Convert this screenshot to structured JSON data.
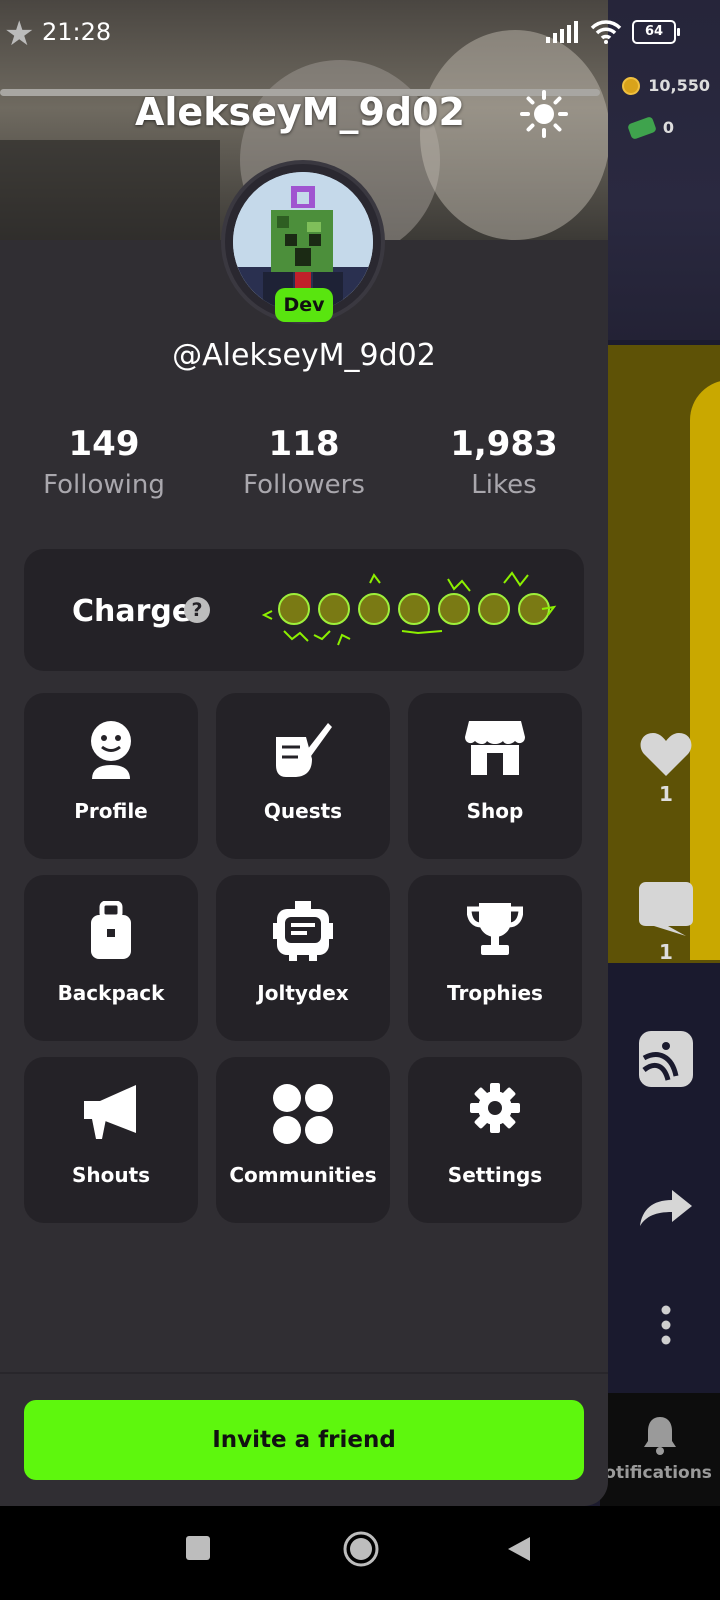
{
  "status_bar": {
    "time": "21:28",
    "battery": "64"
  },
  "drawer": {
    "title": "AlekseyM_9d02",
    "handle": "@AlekseyM_9d02",
    "badge": "Dev",
    "stats": [
      {
        "value": "149",
        "label": "Following"
      },
      {
        "value": "118",
        "label": "Followers"
      },
      {
        "value": "1,983",
        "label": "Likes"
      }
    ],
    "charge": {
      "label": "Charge",
      "help": "?"
    },
    "menu": [
      {
        "label": "Profile",
        "icon": "profile-icon"
      },
      {
        "label": "Quests",
        "icon": "quests-icon"
      },
      {
        "label": "Shop",
        "icon": "shop-icon"
      },
      {
        "label": "Backpack",
        "icon": "backpack-icon"
      },
      {
        "label": "Joltydex",
        "icon": "joltydex-icon"
      },
      {
        "label": "Trophies",
        "icon": "trophy-icon"
      },
      {
        "label": "Shouts",
        "icon": "megaphone-icon"
      },
      {
        "label": "Communities",
        "icon": "communities-icon"
      },
      {
        "label": "Settings",
        "icon": "gear-icon"
      }
    ],
    "invite_label": "Invite a friend"
  },
  "background": {
    "coins": "10,550",
    "cash": "0",
    "likes_count": "1",
    "comments_count": "1",
    "notifications_label": "Notifications"
  },
  "colors": {
    "accent_green": "#5ef70d",
    "badge_green": "#59e50f",
    "drawer_bg": "#302e33",
    "card_bg": "#242227"
  }
}
